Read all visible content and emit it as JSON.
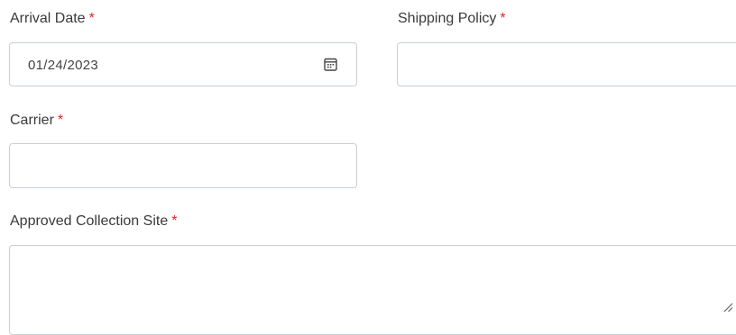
{
  "form": {
    "arrival_date": {
      "label": "Arrival Date",
      "required_mark": "*",
      "value": "01/24/2023",
      "icon": "calendar-icon"
    },
    "shipping_policy": {
      "label": "Shipping Policy",
      "required_mark": "*",
      "value": ""
    },
    "carrier": {
      "label": "Carrier",
      "required_mark": "*",
      "value": ""
    },
    "approved_collection_site": {
      "label": "Approved Collection Site",
      "required_mark": "*",
      "value": ""
    }
  },
  "colors": {
    "required": "#e0262b",
    "border": "#c9cfd6",
    "label_text": "#3a3a3a"
  }
}
